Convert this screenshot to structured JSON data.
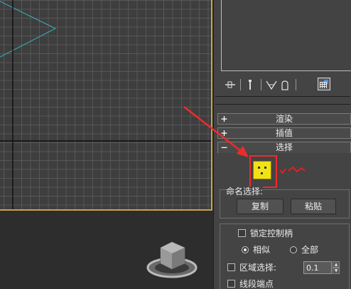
{
  "command_panel": {
    "toolbar": {
      "icons": [
        "pin-stack-icon",
        "show-end-result-icon",
        "make-unique-icon",
        "remove-modifier-icon",
        "configure-modifier-sets-icon"
      ]
    },
    "rollouts": [
      {
        "sign": "+",
        "title": "渲染"
      },
      {
        "sign": "+",
        "title": "插值"
      },
      {
        "sign": "−",
        "title": "选择"
      }
    ],
    "named_selections": {
      "label": "命名选择:",
      "copy_button": "复制",
      "paste_button": "粘贴"
    },
    "lock_handles": {
      "label": "锁定控制柄",
      "checked": false
    },
    "mode": {
      "similar": {
        "label": "相似",
        "selected": true
      },
      "all": {
        "label": "全部",
        "selected": false
      }
    },
    "area_select": {
      "label": "区域选择:",
      "checked": false,
      "value": "0.1"
    },
    "segment_ends": {
      "label": "线段端点",
      "checked": false
    }
  },
  "colors": {
    "viewport_border": "#c9a34a",
    "annotation_red": "#f02a2a",
    "vertex_button": "#f1e313"
  }
}
